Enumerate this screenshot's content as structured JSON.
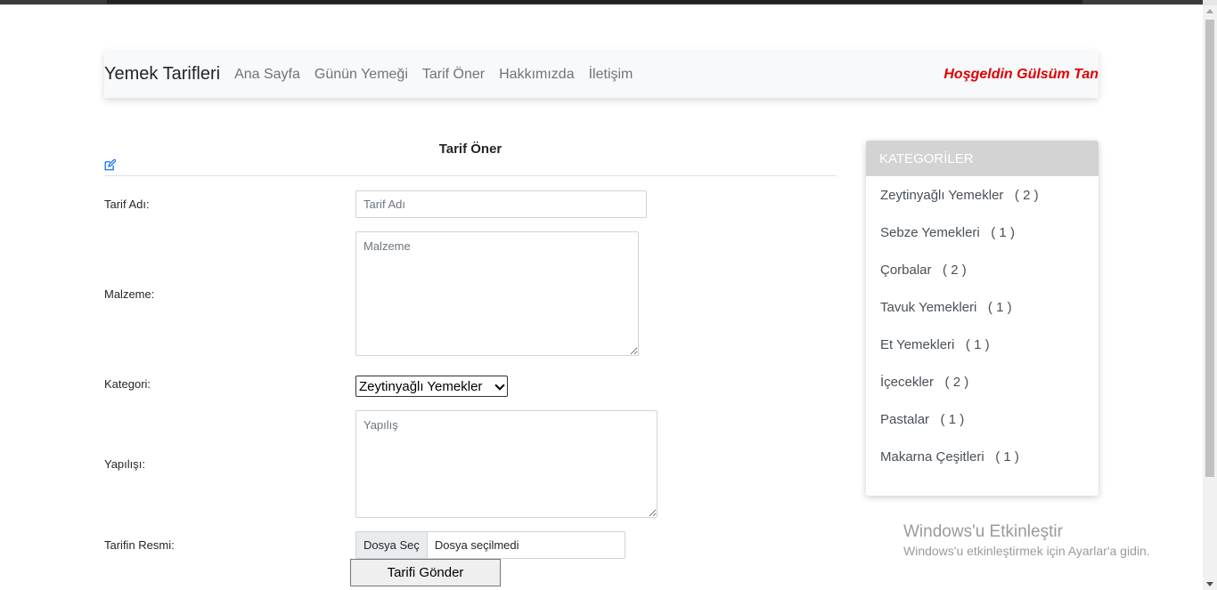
{
  "navbar": {
    "brand": "Yemek Tarifleri",
    "links": [
      "Ana Sayfa",
      "Günün Yemeği",
      "Tarif Öner",
      "Hakkımızda",
      "İletişim"
    ],
    "welcome": "Hoşgeldin Gülsüm Tan"
  },
  "form": {
    "title": "Tarif Öner",
    "name_label": "Tarif Adı:",
    "name_placeholder": "Tarif Adı",
    "ingredients_label": "Malzeme:",
    "ingredients_placeholder": "Malzeme",
    "category_label": "Kategori:",
    "category_selected": "Zeytinyağlı Yemekler",
    "method_label": "Yapılışı:",
    "method_placeholder": "Yapılış",
    "image_label": "Tarifin Resmi:",
    "file_button": "Dosya Seç",
    "file_status": "Dosya seçilmedi",
    "submit": "Tarifi Gönder"
  },
  "sidebar": {
    "header": "KATEGORİLER",
    "categories": [
      {
        "label": "Zeytinyağlı Yemekler",
        "count": "( 2 )"
      },
      {
        "label": "Sebze Yemekleri",
        "count": "( 1 )"
      },
      {
        "label": "Çorbalar",
        "count": "( 2 )"
      },
      {
        "label": "Tavuk Yemekleri",
        "count": "( 1 )"
      },
      {
        "label": "Et Yemekleri",
        "count": "( 1 )"
      },
      {
        "label": "İçecekler",
        "count": "( 2 )"
      },
      {
        "label": "Pastalar",
        "count": "( 1 )"
      },
      {
        "label": "Makarna Çeşitleri",
        "count": "( 1 )"
      }
    ]
  },
  "watermark": {
    "title": "Windows'u Etkinleştir",
    "subtitle": "Windows'u etkinleştirmek için Ayarlar'a gidin."
  },
  "colors": {
    "welcome": "#e00000",
    "link": "#6c757d",
    "sidebar_header_bg": "#d3d3d3",
    "edit_icon": "#0d6efd"
  }
}
